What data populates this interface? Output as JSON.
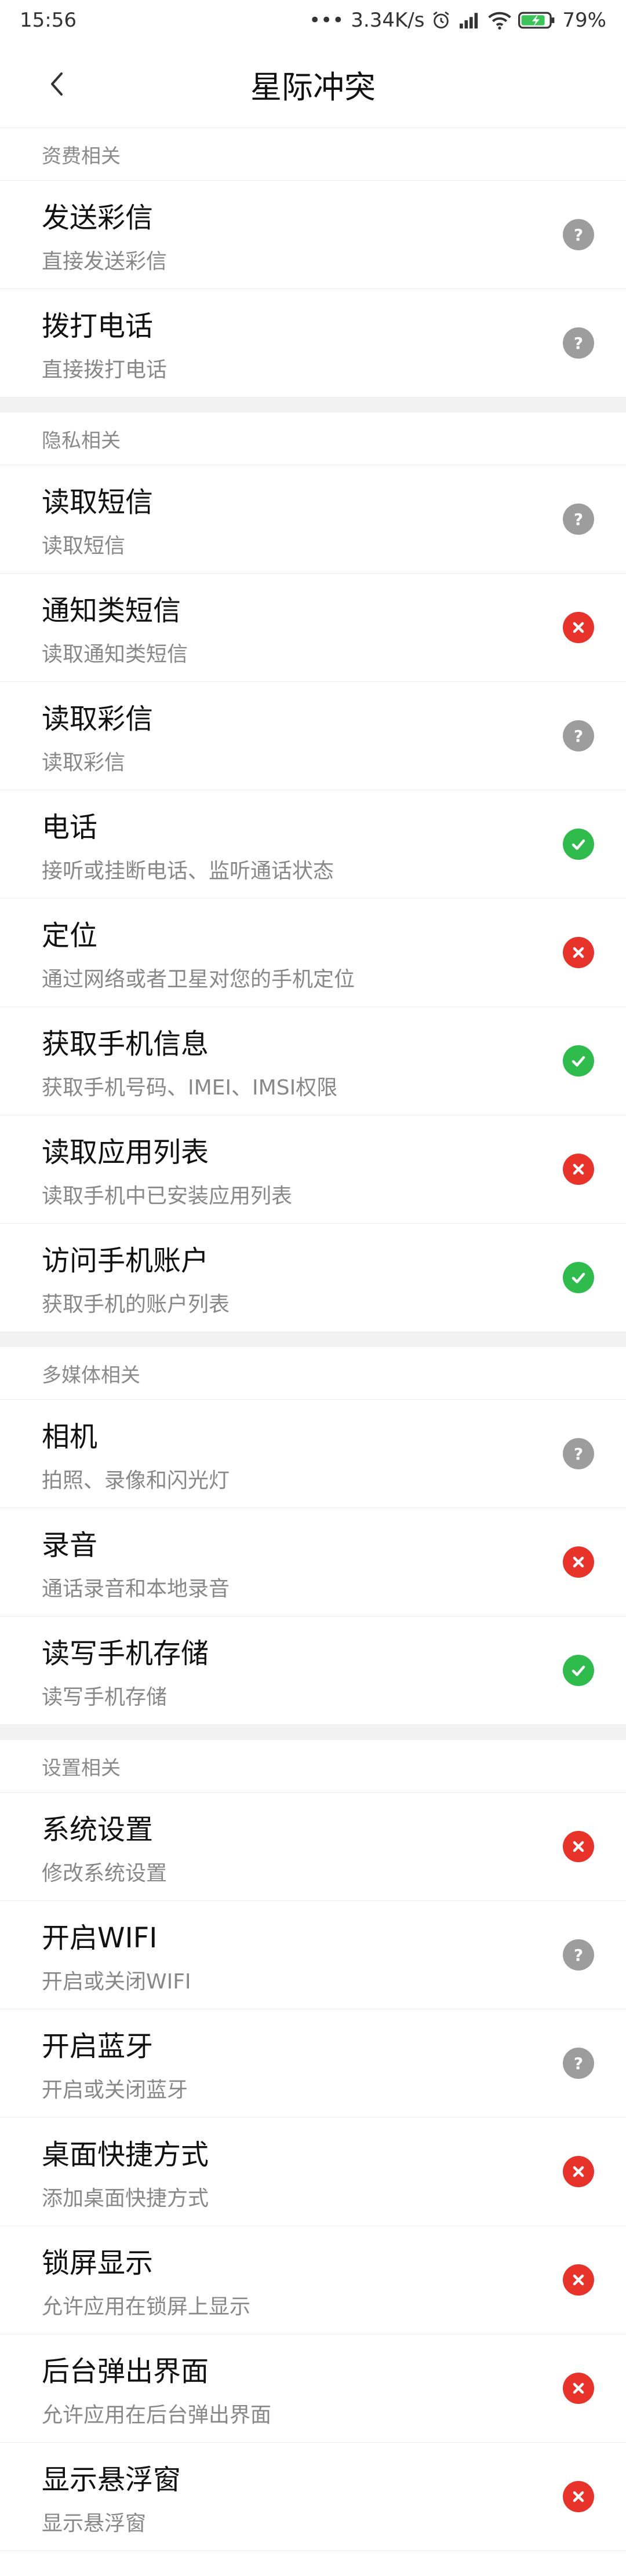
{
  "status_bar": {
    "time": "15:56",
    "dots": "•••",
    "speed": "3.34K/s",
    "battery": "79%"
  },
  "header": {
    "title": "星际冲突"
  },
  "sections": [
    {
      "header": "资费相关",
      "items": [
        {
          "title": "发送彩信",
          "subtitle": "直接发送彩信",
          "status": "ask"
        },
        {
          "title": "拨打电话",
          "subtitle": "直接拨打电话",
          "status": "ask"
        }
      ]
    },
    {
      "header": "隐私相关",
      "items": [
        {
          "title": "读取短信",
          "subtitle": "读取短信",
          "status": "ask"
        },
        {
          "title": "通知类短信",
          "subtitle": "读取通知类短信",
          "status": "deny"
        },
        {
          "title": "读取彩信",
          "subtitle": "读取彩信",
          "status": "ask"
        },
        {
          "title": "电话",
          "subtitle": "接听或挂断电话、监听通话状态",
          "status": "allow"
        },
        {
          "title": "定位",
          "subtitle": "通过网络或者卫星对您的手机定位",
          "status": "deny"
        },
        {
          "title": "获取手机信息",
          "subtitle": "获取手机号码、IMEI、IMSI权限",
          "status": "allow"
        },
        {
          "title": "读取应用列表",
          "subtitle": "读取手机中已安装应用列表",
          "status": "deny"
        },
        {
          "title": "访问手机账户",
          "subtitle": "获取手机的账户列表",
          "status": "allow"
        }
      ]
    },
    {
      "header": "多媒体相关",
      "items": [
        {
          "title": "相机",
          "subtitle": "拍照、录像和闪光灯",
          "status": "ask"
        },
        {
          "title": "录音",
          "subtitle": "通话录音和本地录音",
          "status": "deny"
        },
        {
          "title": "读写手机存储",
          "subtitle": "读写手机存储",
          "status": "allow"
        }
      ]
    },
    {
      "header": "设置相关",
      "items": [
        {
          "title": "系统设置",
          "subtitle": "修改系统设置",
          "status": "deny"
        },
        {
          "title": "开启WIFI",
          "subtitle": "开启或关闭WIFI",
          "status": "ask"
        },
        {
          "title": "开启蓝牙",
          "subtitle": "开启或关闭蓝牙",
          "status": "ask"
        },
        {
          "title": "桌面快捷方式",
          "subtitle": "添加桌面快捷方式",
          "status": "deny"
        },
        {
          "title": "锁屏显示",
          "subtitle": "允许应用在锁屏上显示",
          "status": "deny"
        },
        {
          "title": "后台弹出界面",
          "subtitle": "允许应用在后台弹出界面",
          "status": "deny"
        },
        {
          "title": "显示悬浮窗",
          "subtitle": "显示悬浮窗",
          "status": "deny"
        }
      ]
    }
  ],
  "colors": {
    "ask": "#9d9d9d",
    "deny": "#e8332b",
    "allow": "#2fbc4d"
  }
}
